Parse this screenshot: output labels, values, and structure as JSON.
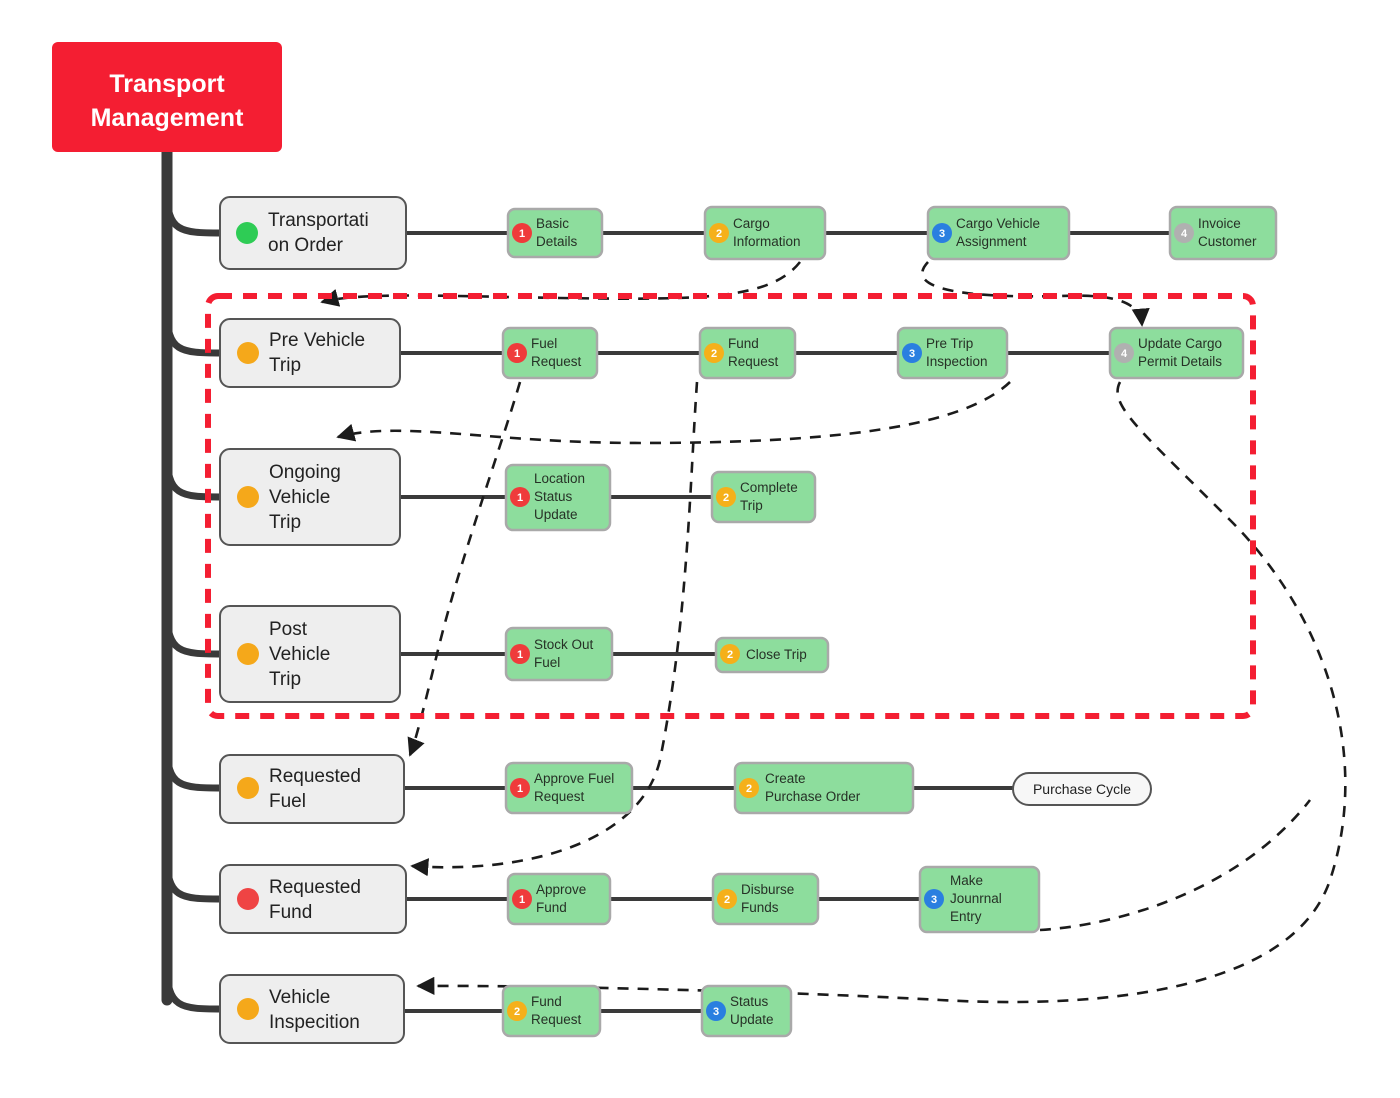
{
  "diagram": {
    "title": "Transport Management",
    "root": {
      "label": "Transport Management",
      "color": "#f41e32",
      "text_color": "#ffffff"
    },
    "palette": {
      "badge_1": "#ef3b3b",
      "badge_2": "#f5b01a",
      "badge_3": "#2a7fe0",
      "badge_4": "#b0b0b0",
      "dot_green": "#2ecc55",
      "dot_orange": "#f5a81a",
      "dot_red": "#ef4444",
      "step_fill": "#8ddd9d",
      "category_fill": "#eeeeee",
      "group_outline": "#f41e32",
      "connector": "#3a3a3a"
    },
    "group_box": {
      "label": "vehicle-trip-group",
      "outline_style": "dashed",
      "outline_color": "#f41e32"
    },
    "branches": [
      {
        "id": "transportation-order",
        "label": "Transportati on Order",
        "dot": "green",
        "steps": [
          {
            "num": "1",
            "badge": "red",
            "label": "Basic Details"
          },
          {
            "num": "2",
            "badge": "orange",
            "label": "Cargo Information"
          },
          {
            "num": "3",
            "badge": "blue",
            "label": "Cargo Vehicle Assignment"
          },
          {
            "num": "4",
            "badge": "gray",
            "label": "Invoice Customer"
          }
        ]
      },
      {
        "id": "pre-vehicle-trip",
        "label": "Pre Vehicle Trip",
        "dot": "orange",
        "steps": [
          {
            "num": "1",
            "badge": "red",
            "label": "Fuel Request"
          },
          {
            "num": "2",
            "badge": "orange",
            "label": "Fund Request"
          },
          {
            "num": "3",
            "badge": "blue",
            "label": "Pre Trip Inspection"
          },
          {
            "num": "4",
            "badge": "gray",
            "label": "Update Cargo Permit Details"
          }
        ]
      },
      {
        "id": "ongoing-vehicle-trip",
        "label": "Ongoing Vehicle Trip",
        "dot": "orange",
        "steps": [
          {
            "num": "1",
            "badge": "red",
            "label": "Location Status Update"
          },
          {
            "num": "2",
            "badge": "orange",
            "label": "Complete Trip"
          }
        ]
      },
      {
        "id": "post-vehicle-trip",
        "label": "Post Vehicle Trip",
        "dot": "orange",
        "steps": [
          {
            "num": "1",
            "badge": "red",
            "label": "Stock Out Fuel"
          },
          {
            "num": "2",
            "badge": "orange",
            "label": "Close Trip"
          }
        ]
      },
      {
        "id": "requested-fuel",
        "label": "Requested Fuel",
        "dot": "orange",
        "steps": [
          {
            "num": "1",
            "badge": "red",
            "label": "Approve Fuel Request"
          },
          {
            "num": "2",
            "badge": "orange",
            "label": "Create Purchase Order"
          },
          {
            "num": "",
            "badge": "none",
            "label": "Purchase Cycle"
          }
        ]
      },
      {
        "id": "requested-fund",
        "label": "Requested Fund",
        "dot": "red",
        "steps": [
          {
            "num": "1",
            "badge": "red",
            "label": "Approve Fund"
          },
          {
            "num": "2",
            "badge": "orange",
            "label": "Disburse Funds"
          },
          {
            "num": "3",
            "badge": "blue",
            "label": "Make Jounrnal Entry"
          }
        ]
      },
      {
        "id": "vehicle-inspection",
        "label": "Vehicle Inspecition",
        "dot": "orange",
        "steps": [
          {
            "num": "2",
            "badge": "orange",
            "label": "Fund Request"
          },
          {
            "num": "3",
            "badge": "blue",
            "label": "Status Update"
          }
        ]
      }
    ],
    "node_text": {
      "transportation_order_line1": "Transportati",
      "transportation_order_line2": "on Order",
      "pre_vehicle_trip_line1": "Pre Vehicle",
      "pre_vehicle_trip_line2": "Trip",
      "ongoing_line1": "Ongoing",
      "ongoing_line2": "Vehicle",
      "ongoing_line3": "Trip",
      "post_line1": "Post",
      "post_line2": "Vehicle",
      "post_line3": "Trip",
      "req_fuel_line1": "Requested",
      "req_fuel_line2": "Fuel",
      "req_fund_line1": "Requested",
      "req_fund_line2": "Fund",
      "veh_insp_line1": "Vehicle",
      "veh_insp_line2": "Inspecition",
      "basic_l1": "Basic",
      "basic_l2": "Details",
      "cargo_info_l1": "Cargo",
      "cargo_info_l2": "Information",
      "cargo_veh_l1": "Cargo Vehicle",
      "cargo_veh_l2": "Assignment",
      "invoice_l1": "Invoice",
      "invoice_l2": "Customer",
      "fuel_req_l1": "Fuel",
      "fuel_req_l2": "Request",
      "fund_req_l1": "Fund",
      "fund_req_l2": "Request",
      "pre_trip_l1": "Pre Trip",
      "pre_trip_l2": "Inspection",
      "update_cargo_l1": "Update Cargo",
      "update_cargo_l2": "Permit Details",
      "loc_status_l1": "Location",
      "loc_status_l2": "Status",
      "loc_status_l3": "Update",
      "complete_trip_l1": "Complete",
      "complete_trip_l2": "Trip",
      "stock_out_l1": "Stock Out",
      "stock_out_l2": "Fuel",
      "close_trip_l1": "Close Trip",
      "approve_fuel_l1": "Approve Fuel",
      "approve_fuel_l2": "Request",
      "create_po_l1": "Create",
      "create_po_l2": "Purchase Order",
      "purchase_cycle_l1": "Purchase Cycle",
      "approve_fund_l1": "Approve",
      "approve_fund_l2": "Fund",
      "disburse_l1": "Disburse",
      "disburse_l2": "Funds",
      "make_journal_l1": "Make",
      "make_journal_l2": "Jounrnal",
      "make_journal_l3": "Entry",
      "vi_fund_req_l1": "Fund",
      "vi_fund_req_l2": "Request",
      "vi_status_l1": "Status",
      "vi_status_l2": "Update",
      "root_l1": "Transport",
      "root_l2": "Management"
    },
    "numbers": {
      "n1": "1",
      "n2": "2",
      "n3": "3",
      "n4": "4"
    }
  }
}
